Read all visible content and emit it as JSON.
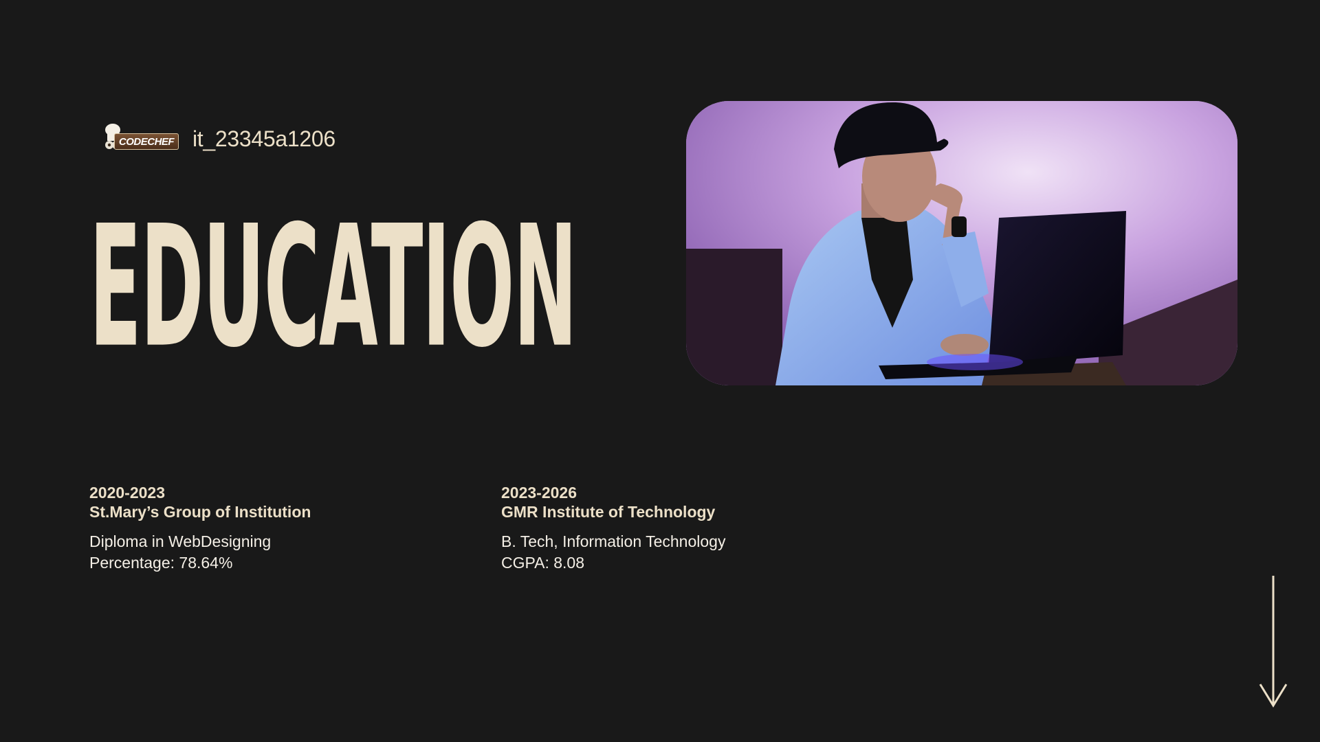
{
  "profile": {
    "codechef_logo_text": "CODECHEF",
    "codechef_handle": "it_23345a1206"
  },
  "section": {
    "title": "EDUCATION"
  },
  "photo": {
    "description_icon": "profile-photo"
  },
  "education": [
    {
      "years": "2020-2023",
      "institution": "St.Mary’s Group of Institution",
      "course": "Diploma in WebDesigning",
      "score": "Percentage: 78.64%"
    },
    {
      "years": "2023-2026",
      "institution": "GMR Institute of Technology",
      "course": "B. Tech, Information Technology",
      "score": "CGPA: 8.08"
    }
  ],
  "nav": {
    "scroll_icon": "arrow-down-icon"
  },
  "colors": {
    "background": "#191919",
    "accent": "#ece0c8",
    "body_text": "#f4efe6"
  }
}
